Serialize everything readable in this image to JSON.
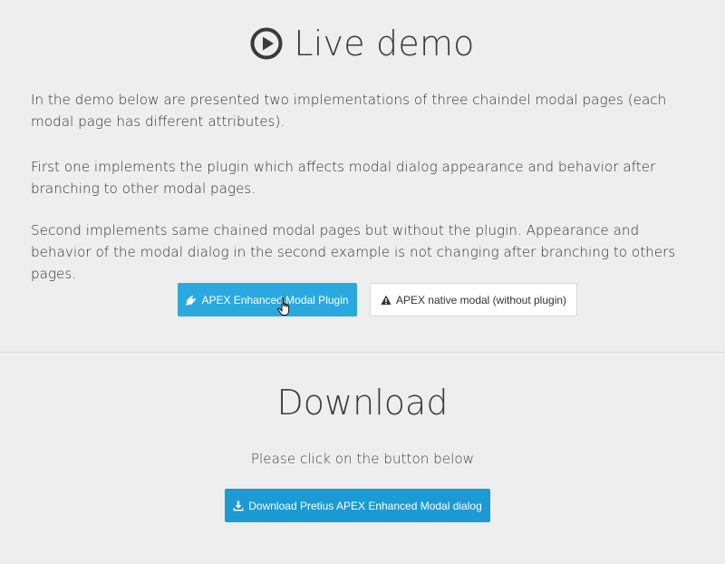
{
  "demo": {
    "title": "Live demo",
    "title_icon": "play-circle-icon",
    "paragraphs": [
      "In the demo below are presented two implementations of three chaindel modal pages (each modal page has different attributes).",
      "First one implements the plugin which affects modal dialog appearance and behavior after branching to other modal pages.",
      "Second implements same chained modal pages but without the plugin. Appearance and behavior of the modal dialog in the second example is not changing after branching to others pages."
    ],
    "buttons": {
      "plugin_label": "APEX Enhanced Modal Plugin",
      "plugin_icon": "plug-icon",
      "native_label": "APEX native modal (without plugin)",
      "native_icon": "warning-icon"
    }
  },
  "download": {
    "title": "Download",
    "subtitle": "Please click on the button below",
    "button_label": "Download Pretius APEX Enhanced Modal dialog",
    "button_icon": "download-icon"
  },
  "colors": {
    "background": "#eeeeee",
    "primary_button": "#2aa9df",
    "download_button": "#1b9ad3",
    "text": "#333333"
  }
}
